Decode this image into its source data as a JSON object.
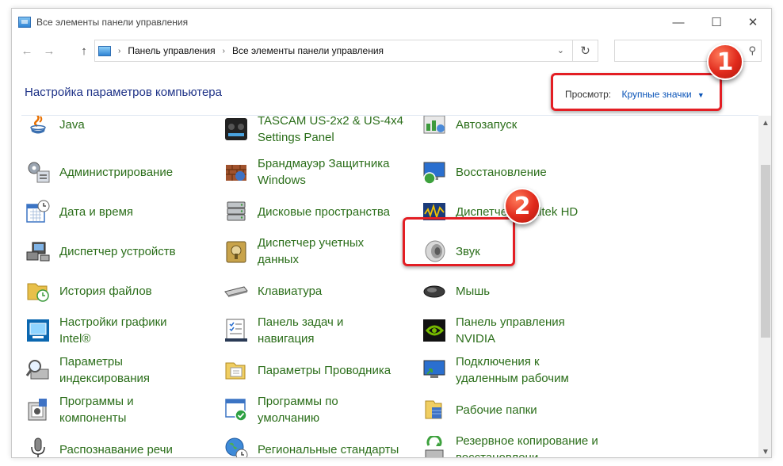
{
  "window": {
    "title": "Все элементы панели управления",
    "minimize": "—",
    "maximize": "☐",
    "close": "✕"
  },
  "nav": {
    "back": "←",
    "forward": "→",
    "up": "↑",
    "breadcrumb": [
      "Панель управления",
      "Все элементы панели управления"
    ],
    "separator": "›",
    "dropdown": "⌄",
    "refresh": "↻",
    "search_placeholder": "",
    "search_icon": "⚲"
  },
  "header": {
    "title": "Настройка параметров компьютера",
    "view_label": "Просмотр:",
    "view_value": "Крупные значки",
    "view_caret": "▼"
  },
  "items": [
    {
      "label": "Java",
      "icon": "java-icon"
    },
    {
      "label": "TASCAM US-2x2 & US-4x4\nSettings Panel",
      "icon": "tascam-icon"
    },
    {
      "label": "Автозапуск",
      "icon": "autoplay-icon"
    },
    {
      "label": "Администрирование",
      "icon": "admin-tools-icon"
    },
    {
      "label": "Брандмауэр Защитника\nWindows",
      "icon": "firewall-icon"
    },
    {
      "label": "Восстановление",
      "icon": "recovery-icon"
    },
    {
      "label": "Дата и время",
      "icon": "date-time-icon"
    },
    {
      "label": "Дисковые пространства",
      "icon": "storage-spaces-icon"
    },
    {
      "label": "Диспетчер Realtek HD",
      "icon": "realtek-icon"
    },
    {
      "label": "Диспетчер устройств",
      "icon": "device-manager-icon"
    },
    {
      "label": "Диспетчер учетных\nданных",
      "icon": "credential-manager-icon"
    },
    {
      "label": "Звук",
      "icon": "sound-icon"
    },
    {
      "label": "История файлов",
      "icon": "file-history-icon"
    },
    {
      "label": "Клавиатура",
      "icon": "keyboard-icon"
    },
    {
      "label": "Мышь",
      "icon": "mouse-icon"
    },
    {
      "label": "Настройки графики\nIntel®",
      "icon": "intel-graphics-icon"
    },
    {
      "label": "Панель задач и\nнавигация",
      "icon": "taskbar-icon"
    },
    {
      "label": "Панель управления\nNVIDIA",
      "icon": "nvidia-icon"
    },
    {
      "label": "Параметры\nиндексирования",
      "icon": "indexing-icon"
    },
    {
      "label": "Параметры Проводника",
      "icon": "explorer-options-icon"
    },
    {
      "label": "Подключения к\nудаленным рабочим",
      "icon": "remote-desktop-icon"
    },
    {
      "label": "Программы и\nкомпоненты",
      "icon": "programs-icon"
    },
    {
      "label": "Программы по\nумолчанию",
      "icon": "default-programs-icon"
    },
    {
      "label": "Рабочие папки",
      "icon": "work-folders-icon"
    },
    {
      "label": "Распознавание речи",
      "icon": "speech-icon"
    },
    {
      "label": "Региональные стандарты",
      "icon": "region-icon"
    },
    {
      "label": "Резервное копирование и\nвосстановлени...",
      "icon": "backup-icon"
    }
  ],
  "annotations": {
    "badge1": "1",
    "badge2": "2",
    "highlight_color": "#e31e24"
  },
  "colors": {
    "link_green": "#2b6e1a",
    "title_blue": "#1e3287",
    "link_blue": "#0a54b8"
  }
}
